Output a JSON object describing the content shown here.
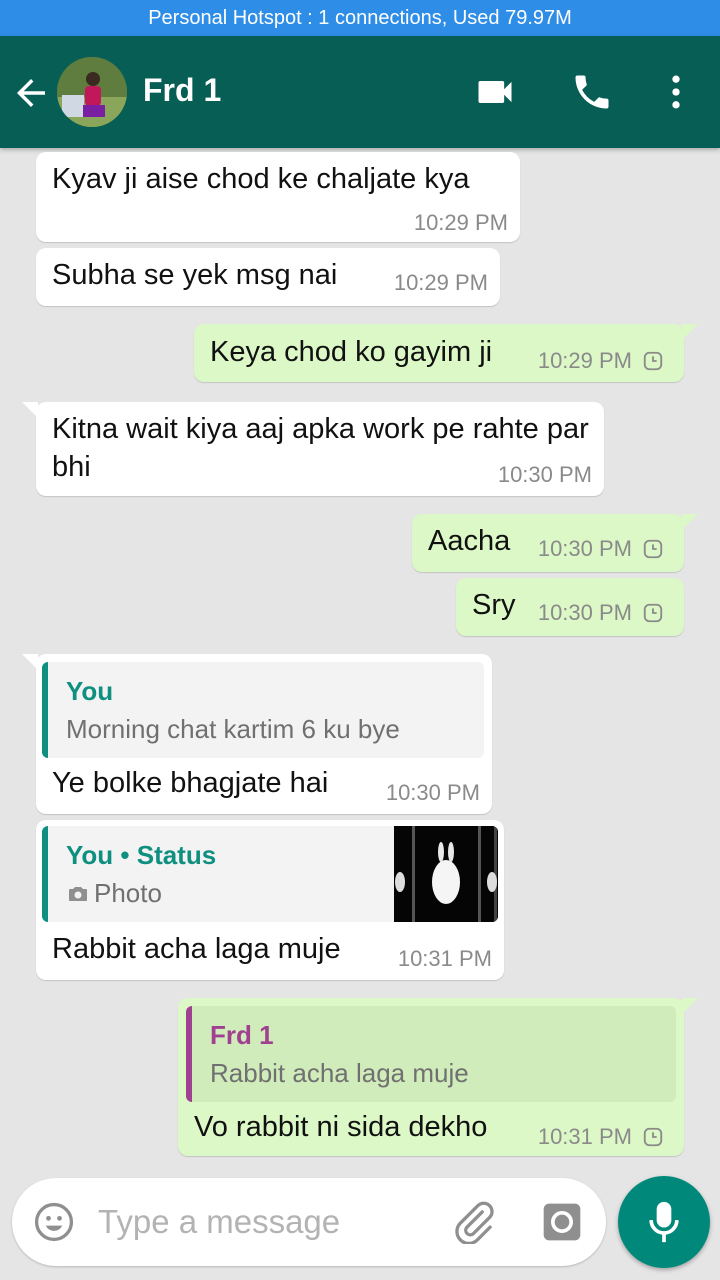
{
  "status_bar": {
    "hotspot_text": "Personal Hotspot : 1 connections, Used 79.97M"
  },
  "header": {
    "contact_name": "Frd 1"
  },
  "colors": {
    "header": "#075e54",
    "hotspot": "#2e8de6",
    "outgoing": "#dcf8c6",
    "incoming": "#ffffff",
    "background": "#e5e5e5",
    "accent": "#00897b"
  },
  "messages": [
    {
      "direction": "in",
      "text": "Kyav ji aise chod ke chaljate kya",
      "time": "10:29 PM"
    },
    {
      "direction": "in",
      "text": "Subha se yek msg nai",
      "time": "10:29 PM"
    },
    {
      "direction": "out",
      "text": "Keya chod ko gayim ji",
      "time": "10:29 PM",
      "status_icon": "clock-icon"
    },
    {
      "direction": "in",
      "text": "Kitna wait kiya aaj apka work pe rahte par bhi",
      "time": "10:30 PM"
    },
    {
      "direction": "out",
      "text": "Aacha",
      "time": "10:30 PM",
      "status_icon": "clock-icon"
    },
    {
      "direction": "out",
      "text": "Sry",
      "time": "10:30 PM",
      "status_icon": "clock-icon"
    },
    {
      "direction": "in",
      "quote_author": "You",
      "quote_text": "Morning chat kartim 6 ku bye",
      "text": "Ye bolke bhagjate hai",
      "time": "10:30 PM"
    },
    {
      "direction": "in",
      "quote_author": "You • Status",
      "quote_text": "Photo",
      "quote_icon": "camera-icon",
      "text": "Rabbit acha laga muje",
      "time": "10:31 PM"
    },
    {
      "direction": "out",
      "quote_author": "Frd 1",
      "quote_text": "Rabbit acha laga muje",
      "text": "Vo rabbit ni sida dekho",
      "time": "10:31 PM",
      "status_icon": "clock-icon"
    }
  ],
  "input": {
    "placeholder": "Type a message"
  }
}
